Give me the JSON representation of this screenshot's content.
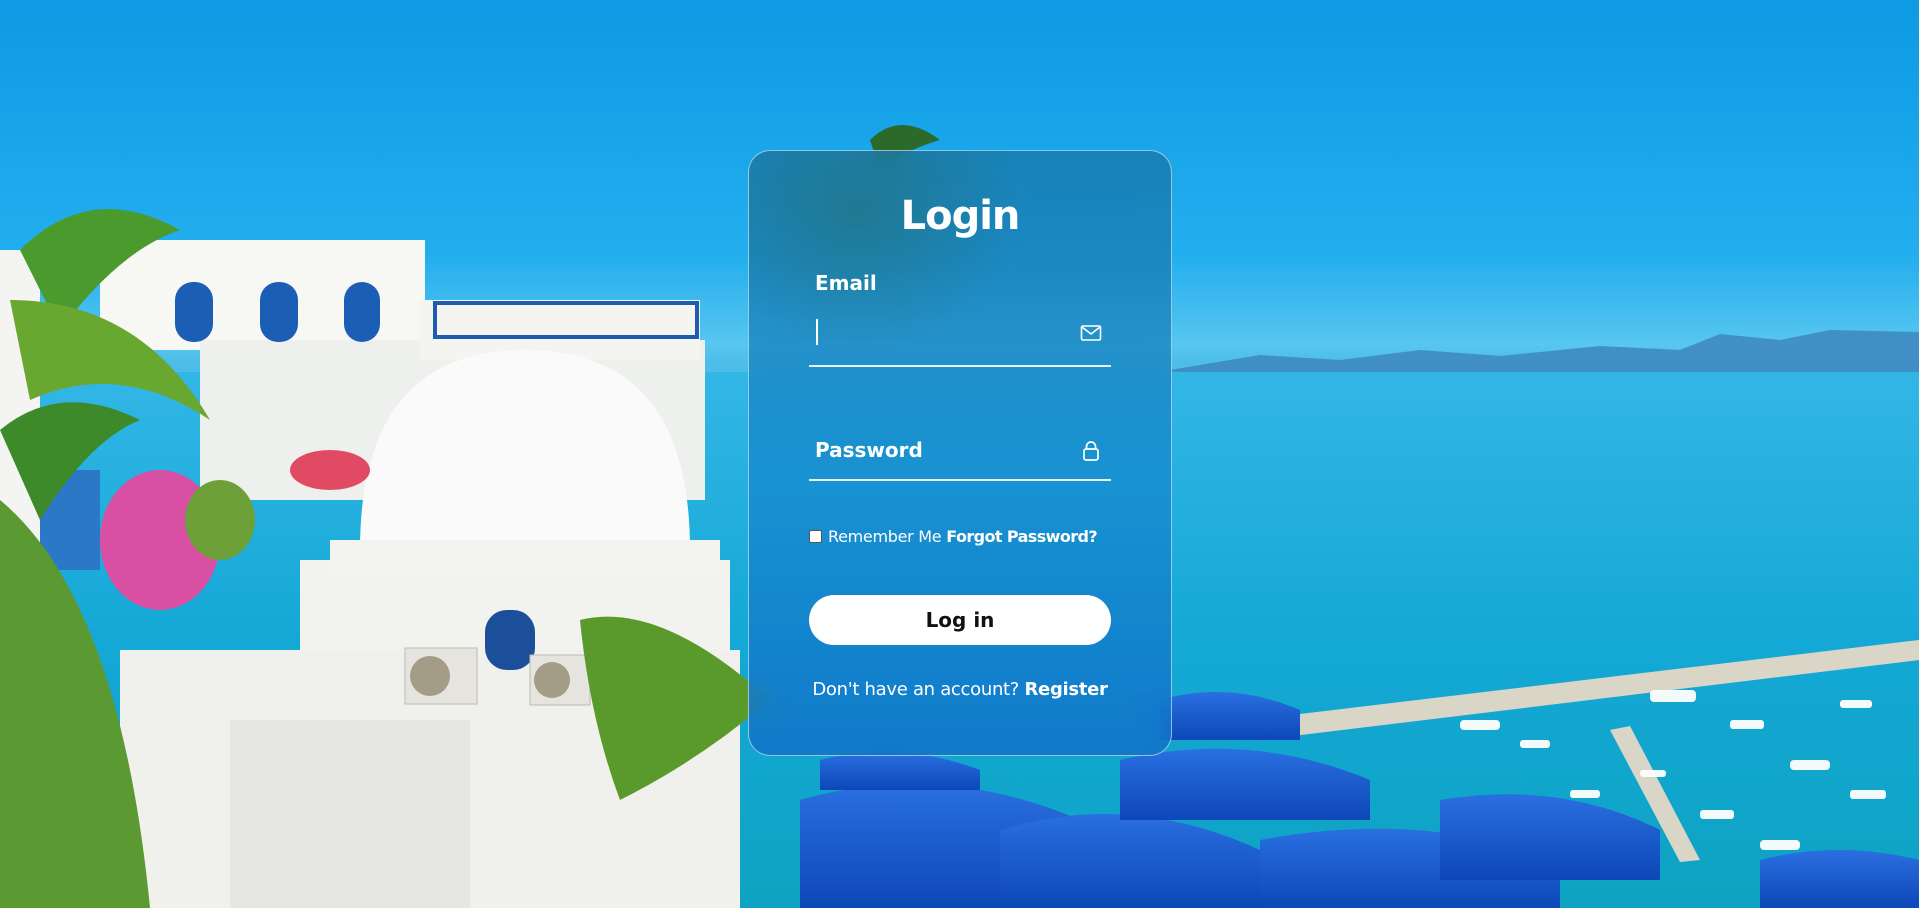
{
  "login": {
    "title": "Login",
    "email_label": "Email",
    "email_value": "",
    "password_placeholder": "Password",
    "remember_label": "Remember Me",
    "remember_checked": false,
    "forgot_label": "Forgot Password?",
    "login_button": "Log in",
    "no_account_text": "Don't have an account?",
    "register_link": "Register"
  },
  "icons": {
    "email": "envelope-icon",
    "password": "lock-icon"
  },
  "colors": {
    "card_tint": "#1a86c4",
    "button_bg": "#ffffff",
    "button_text": "#111111",
    "text": "#ffffff"
  }
}
